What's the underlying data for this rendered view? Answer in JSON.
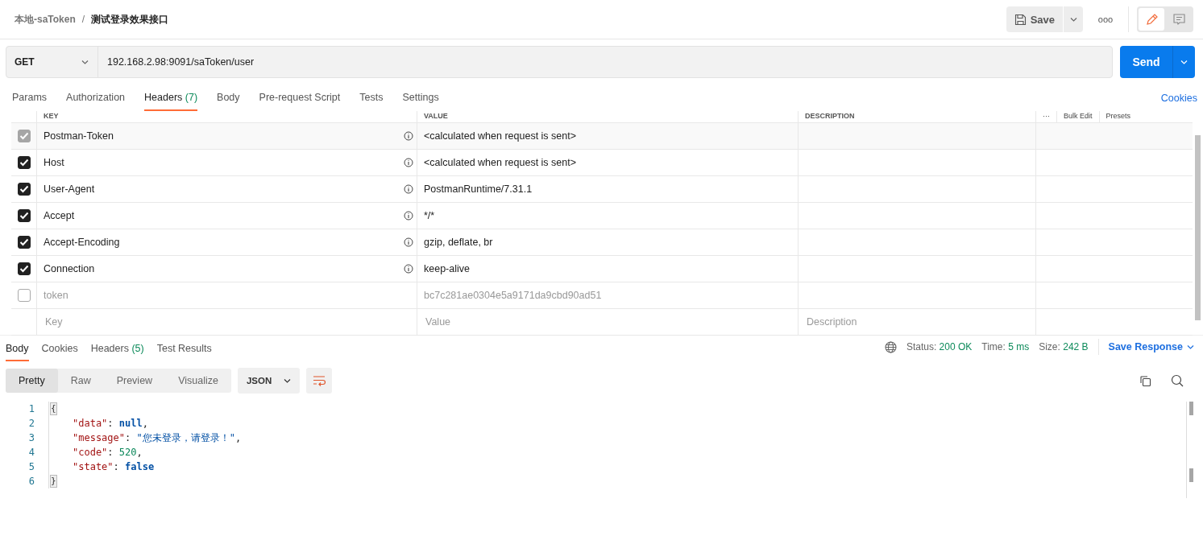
{
  "breadcrumb": {
    "parent": "本地-saToken",
    "separator": "/",
    "current": "测试登录效果接口"
  },
  "toolbar": {
    "save": "Save",
    "more": "ooo",
    "modes": [
      {
        "kind": "edit",
        "selected": true
      },
      {
        "kind": "comment",
        "selected": false
      }
    ]
  },
  "request": {
    "method": "GET",
    "url": "192.168.2.98:9091/saToken/user",
    "send": "Send"
  },
  "request_tabs": [
    {
      "label": "Params",
      "selected": false
    },
    {
      "label": "Authorization",
      "selected": false
    },
    {
      "label": "Headers",
      "count": "(7)",
      "selected": true
    },
    {
      "label": "Body",
      "selected": false
    },
    {
      "label": "Pre-request Script",
      "selected": false
    },
    {
      "label": "Tests",
      "selected": false
    },
    {
      "label": "Settings",
      "selected": false
    }
  ],
  "cookies_link": "Cookies",
  "headers_table": {
    "columns": [
      "KEY",
      "VALUE",
      "DESCRIPTION"
    ],
    "actions": [
      "···",
      "Bulk Edit",
      "Presets"
    ],
    "rows": [
      {
        "key": "Postman-Token",
        "value": "<calculated when request is sent>",
        "checked": true,
        "disabled": true,
        "auto": true
      },
      {
        "key": "Host",
        "value": "<calculated when request is sent>",
        "checked": true,
        "disabled": false,
        "auto": true
      },
      {
        "key": "User-Agent",
        "value": "PostmanRuntime/7.31.1",
        "checked": true,
        "disabled": false,
        "auto": true
      },
      {
        "key": "Accept",
        "value": "*/*",
        "checked": true,
        "disabled": false,
        "auto": true
      },
      {
        "key": "Accept-Encoding",
        "value": "gzip, deflate, br",
        "checked": true,
        "disabled": false,
        "auto": true
      },
      {
        "key": "Connection",
        "value": "keep-alive",
        "checked": true,
        "disabled": false,
        "auto": true
      },
      {
        "key": "token",
        "value": "bc7c281ae0304e5a9171da9cbd90ad51",
        "checked": false,
        "disabled": false,
        "auto": false
      }
    ],
    "new_row": {
      "key_placeholder": "Key",
      "value_placeholder": "Value",
      "description_placeholder": "Description"
    }
  },
  "response_tabs": [
    {
      "label": "Body",
      "selected": true
    },
    {
      "label": "Cookies",
      "selected": false
    },
    {
      "label": "Headers",
      "count": "(5)",
      "selected": false
    },
    {
      "label": "Test Results",
      "selected": false
    }
  ],
  "response_meta": {
    "status_label": "Status:",
    "status": "200 OK",
    "time_label": "Time:",
    "time": "5 ms",
    "size_label": "Size:",
    "size": "242 B",
    "save_response": "Save Response"
  },
  "view_modes": [
    {
      "label": "Pretty",
      "selected": true
    },
    {
      "label": "Raw",
      "selected": false
    },
    {
      "label": "Preview",
      "selected": false
    },
    {
      "label": "Visualize",
      "selected": false
    }
  ],
  "format": "JSON",
  "code_lines": [
    {
      "number": "1",
      "tokens": [
        {
          "kind": "bracket",
          "text": "{"
        }
      ]
    },
    {
      "number": "2",
      "tokens": [
        {
          "kind": "key",
          "text": "\"data\""
        },
        {
          "kind": "punct",
          "text": ": "
        },
        {
          "kind": "keyword",
          "text": "null"
        },
        {
          "kind": "punct",
          "text": ","
        }
      ]
    },
    {
      "number": "3",
      "tokens": [
        {
          "kind": "key",
          "text": "\"message\""
        },
        {
          "kind": "punct",
          "text": ": "
        },
        {
          "kind": "string",
          "text": "\"您未登录，请登录！\""
        },
        {
          "kind": "punct",
          "text": ","
        }
      ]
    },
    {
      "number": "4",
      "tokens": [
        {
          "kind": "key",
          "text": "\"code\""
        },
        {
          "kind": "punct",
          "text": ": "
        },
        {
          "kind": "number",
          "text": "520"
        },
        {
          "kind": "punct",
          "text": ","
        }
      ]
    },
    {
      "number": "5",
      "tokens": [
        {
          "kind": "key",
          "text": "\"state\""
        },
        {
          "kind": "punct",
          "text": ": "
        },
        {
          "kind": "keyword",
          "text": "false"
        }
      ]
    },
    {
      "number": "6",
      "tokens": [
        {
          "kind": "bracket",
          "text": "}"
        }
      ]
    }
  ]
}
